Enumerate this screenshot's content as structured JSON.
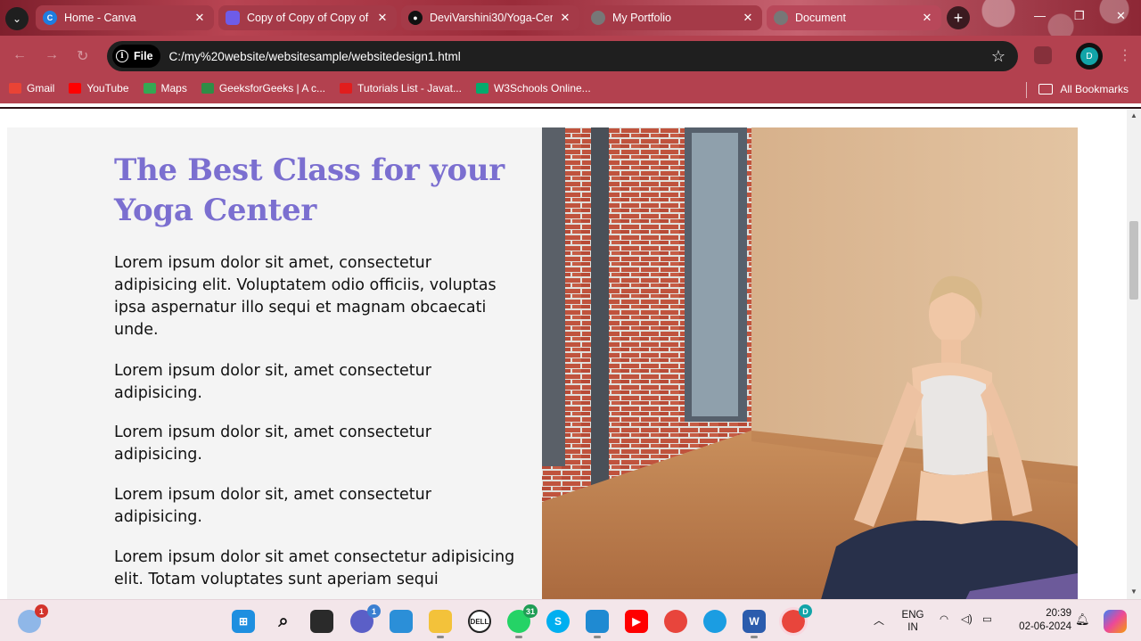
{
  "browser": {
    "tabs": [
      {
        "title": "Home - Canva",
        "icon": "canva-icon",
        "color": "#1f7de0"
      },
      {
        "title": "Copy of Copy of Copy of",
        "icon": "canva-doc-icon",
        "color": "#6e5ce8"
      },
      {
        "title": "DeviVarshini30/Yoga-Cen",
        "icon": "github-icon",
        "color": "#111111"
      },
      {
        "title": "My Portfolio",
        "icon": "globe-icon",
        "color": "#777777"
      },
      {
        "title": "Document",
        "icon": "globe-icon",
        "color": "#777777"
      }
    ],
    "address": {
      "chip_label": "File",
      "url": "C:/my%20website/websitesample/websitedesign1.html"
    },
    "profile_initial": "D",
    "bookmarks": [
      {
        "label": "Gmail",
        "icon": "gmail-icon",
        "color": "#ea4335"
      },
      {
        "label": "YouTube",
        "icon": "youtube-icon",
        "color": "#ff0000"
      },
      {
        "label": "Maps",
        "icon": "maps-icon",
        "color": "#34a853"
      },
      {
        "label": "GeeksforGeeks | A c...",
        "icon": "gfg-icon",
        "color": "#2f8d46"
      },
      {
        "label": "Tutorials List - Javat...",
        "icon": "javatpoint-icon",
        "color": "#e11d1d"
      },
      {
        "label": "W3Schools Online...",
        "icon": "w3schools-icon",
        "color": "#04aa6d"
      }
    ],
    "all_bookmarks": "All Bookmarks"
  },
  "page": {
    "heading": "The Best Class for your Yoga Center",
    "paragraphs": [
      "Lorem ipsum dolor sit amet, consectetur adipisicing elit. Voluptatem odio officiis, voluptas ipsa aspernatur illo sequi et magnam obcaecati unde.",
      "Lorem ipsum dolor sit, amet consectetur adipisicing.",
      "Lorem ipsum dolor sit, amet consectetur adipisicing.",
      "Lorem ipsum dolor sit, amet consectetur adipisicing.",
      "Lorem ipsum dolor sit amet consectetur adipisicing elit. Totam voluptates sunt aperiam sequi"
    ],
    "accent_color": "#7b6fd0"
  },
  "taskbar": {
    "weather_badge": "1",
    "chat_badge": "1",
    "whatsapp_badge": "31",
    "chrome_profile_badge": "D",
    "language": "ENG",
    "region": "IN",
    "time": "20:39",
    "date": "02-06-2024"
  }
}
